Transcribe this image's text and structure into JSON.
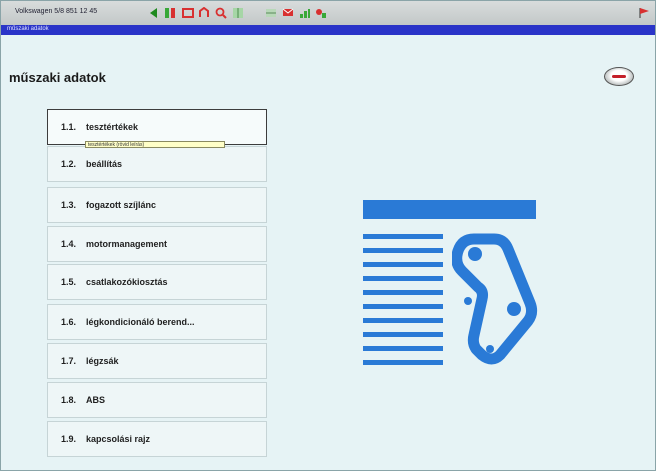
{
  "window": {
    "title": "Volkswagen  5/8 851   12  45",
    "subtitle": "műszaki adatok"
  },
  "page_title": "műszaki adatok",
  "menu": [
    {
      "num": "1.1.",
      "label": "tesztértékek"
    },
    {
      "num": "1.2.",
      "label": "beállítás"
    },
    {
      "num": "1.3.",
      "label": "fogazott szíjlánc"
    },
    {
      "num": "1.4.",
      "label": "motormanagement"
    },
    {
      "num": "1.5.",
      "label": "csatlakozókiosztás"
    },
    {
      "num": "1.6.",
      "label": "légkondicionáló berend..."
    },
    {
      "num": "1.7.",
      "label": "légzsák"
    },
    {
      "num": "1.8.",
      "label": "ABS"
    },
    {
      "num": "1.9.",
      "label": "kapcsolási rajz"
    }
  ],
  "tooltip": "tesztértékek (rövid leírás)",
  "colors": {
    "accent_blue": "#2a7ad6",
    "titlebar_blue": "#2a34c8",
    "toolbar_green": "#38a838",
    "toolbar_red": "#d83030"
  },
  "icons": {
    "toolbar": [
      "back-arrow-icon",
      "forward-arrow-icon",
      "print-icon",
      "stop-icon",
      "search-icon",
      "grid-icon",
      "table-icon",
      "mail-icon",
      "chart-icon",
      "diagram-icon",
      "flag-icon"
    ],
    "illustration": "timing-belt-diagram-icon",
    "brand": "brand-logo"
  }
}
